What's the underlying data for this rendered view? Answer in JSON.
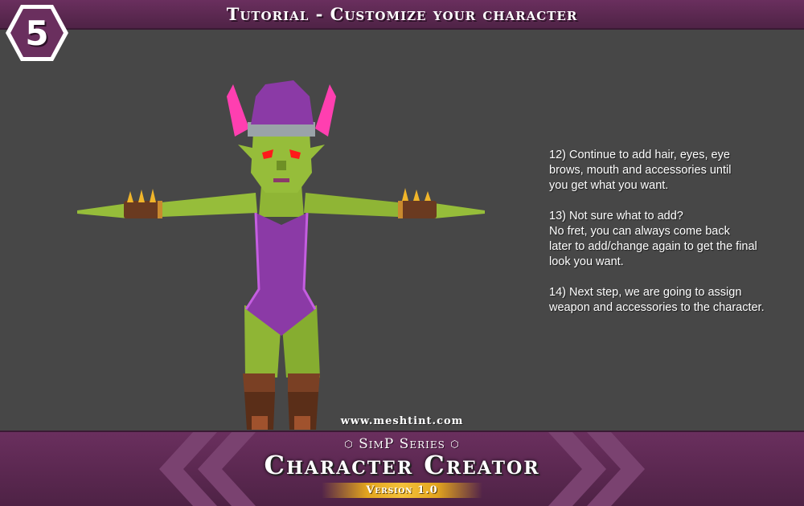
{
  "header": {
    "title": "Tutorial - Customize your character",
    "step_number": "5"
  },
  "instructions": [
    {
      "lines": [
        "12) Continue to add hair, eyes, eye",
        "brows, mouth and accessories until",
        "you get what you want."
      ]
    },
    {
      "lines": [
        "13) Not sure what to add?",
        "No fret, you can always come back",
        "later to add/change again to get the final",
        "look you want."
      ]
    },
    {
      "lines": [
        "14) Next step, we are going to assign",
        "weapon and accessories to the character."
      ]
    }
  ],
  "footer": {
    "website": "www.meshtint.com",
    "series": "SimP Series",
    "product_name": "Character Creator",
    "version": "Version 1.0"
  },
  "colors": {
    "background": "#474747",
    "banner": "#5c2752",
    "badge": "#6a2f5e",
    "skin": "#96bd3a",
    "outfit": "#8b3aa6",
    "horns": "#ff3fb0",
    "eyes": "#ff1a1a",
    "boots": "#6a3a20",
    "version_ribbon": "#e8b02a"
  },
  "icons": {
    "step_badge": "hexagon-badge-icon",
    "series_ornament": "hexagon-outline-icon"
  }
}
